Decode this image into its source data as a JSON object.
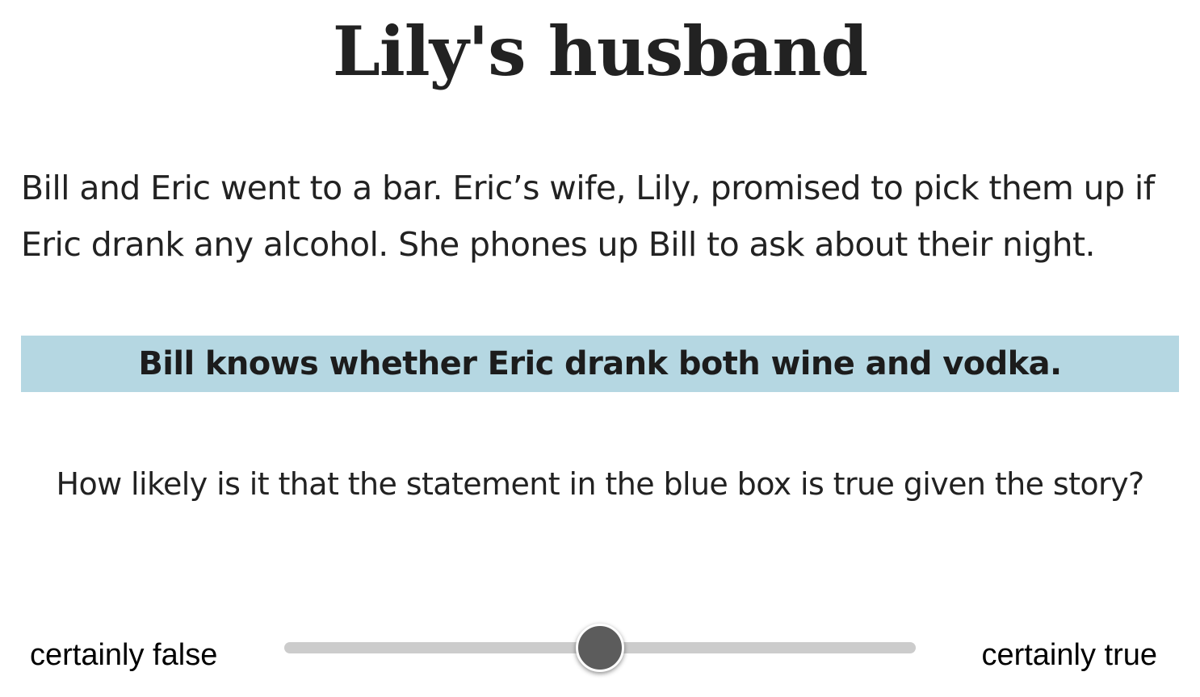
{
  "page": {
    "title": "Lily's husband"
  },
  "story": {
    "text": "Bill and Eric went to a bar. Eric’s wife, Lily, promised to pick them up if Eric drank any alcohol. She phones up Bill to ask about their night."
  },
  "statement": {
    "text": "Bill knows whether Eric drank both wine and vodka.",
    "box_color": "#b5d7e2"
  },
  "question": {
    "text": "How likely is it that the statement in the blue box is true given the story?"
  },
  "response_slider": {
    "min_label": "certainly false",
    "max_label": "certainly true",
    "value": 0.5,
    "track_color": "#cccccc",
    "thumb_color": "#5c5c5c"
  }
}
